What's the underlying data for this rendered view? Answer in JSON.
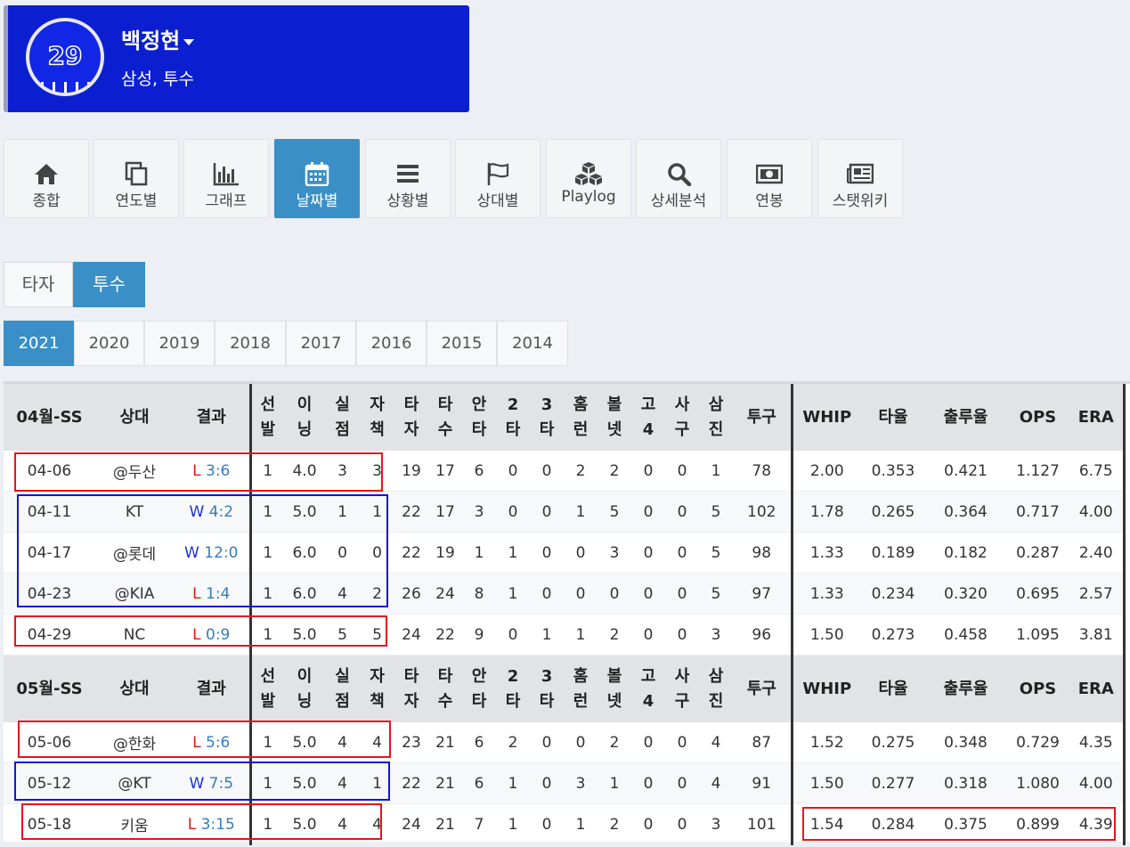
{
  "player": {
    "number": "29",
    "name": "백정현",
    "team_position": "삼성, 투수"
  },
  "nav": [
    {
      "label": "종합",
      "icon": "home-icon"
    },
    {
      "label": "연도별",
      "icon": "copy-icon"
    },
    {
      "label": "그래프",
      "icon": "bar-chart-icon"
    },
    {
      "label": "날짜별",
      "icon": "calendar-icon",
      "active": true
    },
    {
      "label": "상황별",
      "icon": "list-icon"
    },
    {
      "label": "상대별",
      "icon": "flag-icon"
    },
    {
      "label": "Playlog",
      "icon": "cubes-icon"
    },
    {
      "label": "상세분석",
      "icon": "search-icon"
    },
    {
      "label": "연봉",
      "icon": "money-icon"
    },
    {
      "label": "스탯위키",
      "icon": "newspaper-icon"
    }
  ],
  "role_tabs": [
    {
      "label": "타자"
    },
    {
      "label": "투수",
      "active": true
    }
  ],
  "years": [
    "2021",
    "2020",
    "2019",
    "2018",
    "2017",
    "2016",
    "2015",
    "2014"
  ],
  "active_year": "2021",
  "columns": [
    "상대",
    "결과",
    "선발",
    "이닝",
    "실점",
    "자책",
    "타자",
    "타수",
    "안타",
    "2타",
    "3타",
    "홈런",
    "볼넷",
    "고4",
    "사구",
    "삼진",
    "투구",
    "WHIP",
    "타율",
    "출루율",
    "OPS",
    "ERA"
  ],
  "sections": [
    {
      "label": "04월-SS",
      "rows": [
        {
          "date": "04-06",
          "opp": "@두산",
          "wl": "L",
          "score": "3:6",
          "st": "1",
          "ip": "4.0",
          "r": "3",
          "er": "3",
          "bf": "19",
          "ab": "17",
          "h": "6",
          "d": "0",
          "t": "0",
          "hr": "2",
          "bb": "2",
          "ibb": "0",
          "hbp": "0",
          "so": "1",
          "np": "78",
          "whip": "2.00",
          "avg": "0.353",
          "obp": "0.421",
          "ops": "1.127",
          "era": "6.75"
        },
        {
          "date": "04-11",
          "opp": "KT",
          "wl": "W",
          "score": "4:2",
          "st": "1",
          "ip": "5.0",
          "r": "1",
          "er": "1",
          "bf": "22",
          "ab": "17",
          "h": "3",
          "d": "0",
          "t": "0",
          "hr": "1",
          "bb": "5",
          "ibb": "0",
          "hbp": "0",
          "so": "5",
          "np": "102",
          "whip": "1.78",
          "avg": "0.265",
          "obp": "0.364",
          "ops": "0.717",
          "era": "4.00"
        },
        {
          "date": "04-17",
          "opp": "@롯데",
          "wl": "W",
          "score": "12:0",
          "st": "1",
          "ip": "6.0",
          "r": "0",
          "er": "0",
          "bf": "22",
          "ab": "19",
          "h": "1",
          "d": "1",
          "t": "0",
          "hr": "0",
          "bb": "3",
          "ibb": "0",
          "hbp": "0",
          "so": "5",
          "np": "98",
          "whip": "1.33",
          "avg": "0.189",
          "obp": "0.182",
          "ops": "0.287",
          "era": "2.40"
        },
        {
          "date": "04-23",
          "opp": "@KIA",
          "wl": "L",
          "score": "1:4",
          "st": "1",
          "ip": "6.0",
          "r": "4",
          "er": "2",
          "bf": "26",
          "ab": "24",
          "h": "8",
          "d": "1",
          "t": "0",
          "hr": "0",
          "bb": "0",
          "ibb": "0",
          "hbp": "0",
          "so": "5",
          "np": "97",
          "whip": "1.33",
          "avg": "0.234",
          "obp": "0.320",
          "ops": "0.695",
          "era": "2.57"
        },
        {
          "date": "04-29",
          "opp": "NC",
          "wl": "L",
          "score": "0:9",
          "st": "1",
          "ip": "5.0",
          "r": "5",
          "er": "5",
          "bf": "24",
          "ab": "22",
          "h": "9",
          "d": "0",
          "t": "1",
          "hr": "1",
          "bb": "2",
          "ibb": "0",
          "hbp": "0",
          "so": "3",
          "np": "96",
          "whip": "1.50",
          "avg": "0.273",
          "obp": "0.458",
          "ops": "1.095",
          "era": "3.81"
        }
      ]
    },
    {
      "label": "05월-SS",
      "rows": [
        {
          "date": "05-06",
          "opp": "@한화",
          "wl": "L",
          "score": "5:6",
          "st": "1",
          "ip": "5.0",
          "r": "4",
          "er": "4",
          "bf": "23",
          "ab": "21",
          "h": "6",
          "d": "2",
          "t": "0",
          "hr": "0",
          "bb": "2",
          "ibb": "0",
          "hbp": "0",
          "so": "4",
          "np": "87",
          "whip": "1.52",
          "avg": "0.275",
          "obp": "0.348",
          "ops": "0.729",
          "era": "4.35"
        },
        {
          "date": "05-12",
          "opp": "@KT",
          "wl": "W",
          "score": "7:5",
          "st": "1",
          "ip": "5.0",
          "r": "4",
          "er": "1",
          "bf": "22",
          "ab": "21",
          "h": "6",
          "d": "1",
          "t": "0",
          "hr": "3",
          "bb": "1",
          "ibb": "0",
          "hbp": "0",
          "so": "4",
          "np": "91",
          "whip": "1.50",
          "avg": "0.277",
          "obp": "0.318",
          "ops": "1.080",
          "era": "4.00"
        },
        {
          "date": "05-18",
          "opp": "키움",
          "wl": "L",
          "score": "3:15",
          "st": "1",
          "ip": "5.0",
          "r": "4",
          "er": "4",
          "bf": "24",
          "ab": "21",
          "h": "7",
          "d": "1",
          "t": "0",
          "hr": "1",
          "bb": "2",
          "ibb": "0",
          "hbp": "0",
          "so": "3",
          "np": "101",
          "whip": "1.54",
          "avg": "0.284",
          "obp": "0.375",
          "ops": "0.899",
          "era": "4.39"
        }
      ]
    }
  ]
}
